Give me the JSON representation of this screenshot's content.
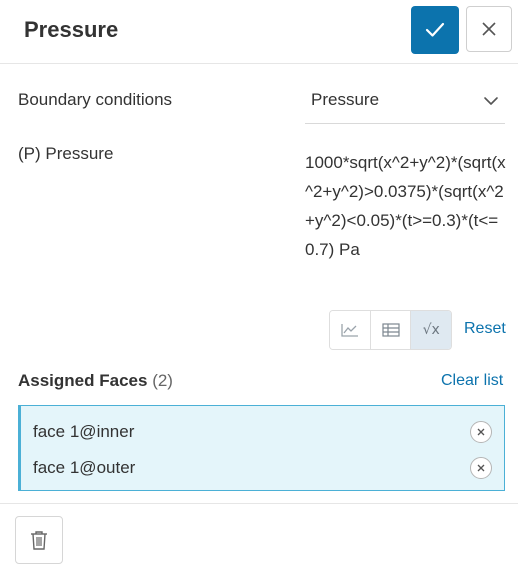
{
  "header": {
    "title": "Pressure",
    "confirm_icon": "checkmark-icon",
    "close_icon": "close-icon",
    "accent_color": "#0c73ad"
  },
  "form": {
    "boundary_conditions": {
      "label": "Boundary conditions",
      "selected": "Pressure"
    },
    "pressure": {
      "label": "(P) Pressure",
      "expression": "1000*sqrt(x^2+y^2)*(sqrt(x^2+y^2)>0.0375)*(sqrt(x^2+y^2)<0.05)*(t>=0.3)*(t<=0.7) Pa",
      "input_modes": [
        {
          "icon": "chart-icon",
          "active": false
        },
        {
          "icon": "table-icon",
          "active": false
        },
        {
          "icon": "formula-icon",
          "glyph": "√x",
          "active": true
        }
      ],
      "reset_label": "Reset"
    }
  },
  "assigned_faces": {
    "title": "Assigned Faces",
    "count": "(2)",
    "clear_label": "Clear list",
    "items": [
      {
        "label": "face 1@inner"
      },
      {
        "label": "face 1@outer"
      }
    ]
  },
  "footer": {
    "delete_icon": "trash-icon"
  }
}
